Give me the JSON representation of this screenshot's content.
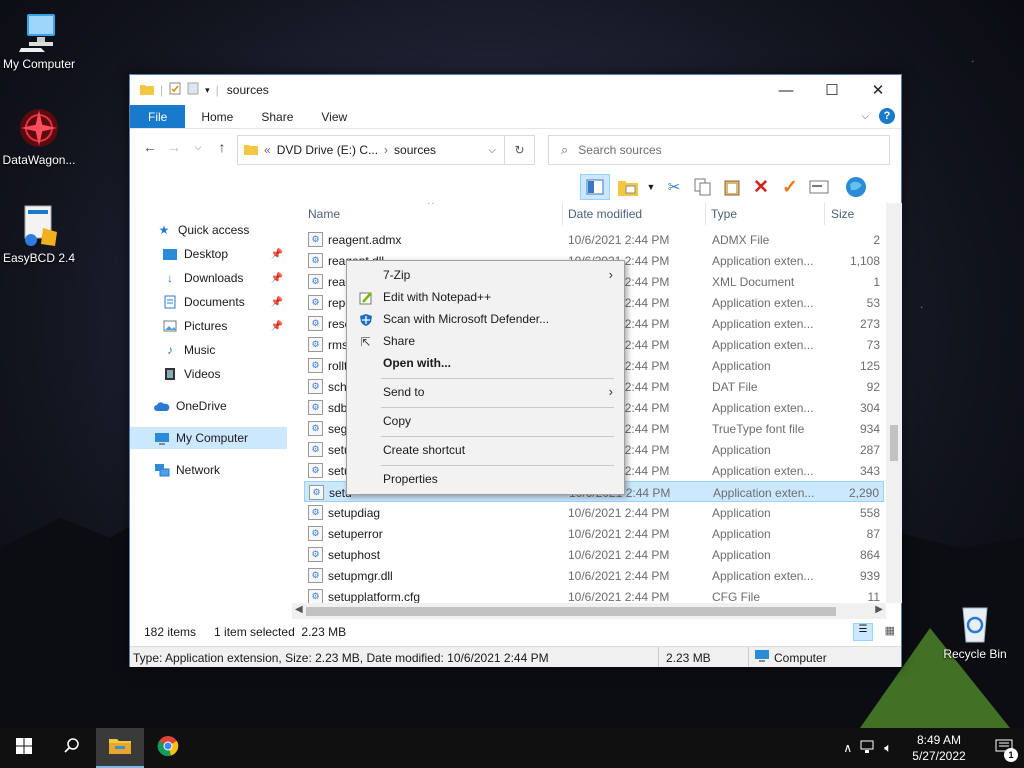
{
  "desktop": {
    "icons": [
      {
        "label": "My Computer"
      },
      {
        "label": "DataWagon..."
      },
      {
        "label": "EasyBCD 2.4"
      },
      {
        "label": "Recycle Bin"
      }
    ]
  },
  "window": {
    "title": "sources",
    "controls": {
      "minimize": "—",
      "maximize": "☐",
      "close": "✕"
    },
    "ribbon": {
      "tabs": [
        "File",
        "Home",
        "Share",
        "View"
      ],
      "help": "?"
    },
    "address": {
      "path": "DVD Drive (E:) C...",
      "separator": "›",
      "current": "sources",
      "prefix": "«"
    },
    "search_placeholder": "Search sources",
    "nav": [
      {
        "label": "Quick access"
      },
      {
        "label": "Desktop"
      },
      {
        "label": "Downloads"
      },
      {
        "label": "Documents"
      },
      {
        "label": "Pictures"
      },
      {
        "label": "Music"
      },
      {
        "label": "Videos"
      },
      {
        "label": "OneDrive"
      },
      {
        "label": "My Computer"
      },
      {
        "label": "Network"
      }
    ],
    "columns": {
      "name": "Name",
      "date": "Date modified",
      "type": "Type",
      "size": "Size"
    },
    "files": [
      {
        "name": "reagent.admx",
        "date": "10/6/2021 2:44 PM",
        "type": "ADMX File",
        "size": "2"
      },
      {
        "name": "reagent.dll",
        "date": "10/6/2021 2:44 PM",
        "type": "Application exten...",
        "size": "1,108"
      },
      {
        "name": "reag",
        "date": "10/6/2021 2:44 PM",
        "type": "XML Document",
        "size": "1"
      },
      {
        "name": "repc",
        "date": "10/6/2021 2:44 PM",
        "type": "Application exten...",
        "size": "53"
      },
      {
        "name": "rese",
        "date": "10/6/2021 2:44 PM",
        "type": "Application exten...",
        "size": "273"
      },
      {
        "name": "rms",
        "date": "10/6/2021 2:44 PM",
        "type": "Application exten...",
        "size": "73"
      },
      {
        "name": "rollt",
        "date": "10/6/2021 2:44 PM",
        "type": "Application",
        "size": "125"
      },
      {
        "name": "sch",
        "date": "10/6/2021 2:44 PM",
        "type": "DAT File",
        "size": "92"
      },
      {
        "name": "sdb",
        "date": "10/6/2021 2:44 PM",
        "type": "Application exten...",
        "size": "304"
      },
      {
        "name": "seg",
        "date": "10/6/2021 2:44 PM",
        "type": "TrueType font file",
        "size": "934"
      },
      {
        "name": "setu",
        "date": "10/6/2021 2:44 PM",
        "type": "Application",
        "size": "287"
      },
      {
        "name": "setu",
        "date": "10/6/2021 2:44 PM",
        "type": "Application exten...",
        "size": "343"
      },
      {
        "name": "setu",
        "date": "10/6/2021 2:44 PM",
        "type": "Application exten...",
        "size": "2,290"
      },
      {
        "name": "setupdiag",
        "date": "10/6/2021 2:44 PM",
        "type": "Application",
        "size": "558"
      },
      {
        "name": "setuperror",
        "date": "10/6/2021 2:44 PM",
        "type": "Application",
        "size": "87"
      },
      {
        "name": "setuphost",
        "date": "10/6/2021 2:44 PM",
        "type": "Application",
        "size": "864"
      },
      {
        "name": "setupmgr.dll",
        "date": "10/6/2021 2:44 PM",
        "type": "Application exten...",
        "size": "939"
      },
      {
        "name": "setupplatform.cfg",
        "date": "10/6/2021 2:44 PM",
        "type": "CFG File",
        "size": "11"
      }
    ],
    "status": {
      "count": "182 items",
      "selected": "1 item selected  2.23 MB"
    },
    "info": {
      "details": "Type: Application extension, Size: 2.23 MB, Date modified: 10/6/2021 2:44 PM",
      "size": "2.23 MB",
      "location": "Computer"
    }
  },
  "context_menu": {
    "items": [
      {
        "label": "7-Zip"
      },
      {
        "label": "Edit with Notepad++"
      },
      {
        "label": "Scan with Microsoft Defender..."
      },
      {
        "label": "Share"
      },
      {
        "label": "Open with..."
      },
      {
        "label": "Send to"
      },
      {
        "label": "Copy"
      },
      {
        "label": "Create shortcut"
      },
      {
        "label": "Properties"
      }
    ]
  },
  "taskbar": {
    "time": "8:49 AM",
    "date": "5/27/2022",
    "notification_count": "1"
  },
  "colors": {
    "accent": "#1979ca",
    "selection": "#cce8ff",
    "taskbar": "#101010"
  }
}
